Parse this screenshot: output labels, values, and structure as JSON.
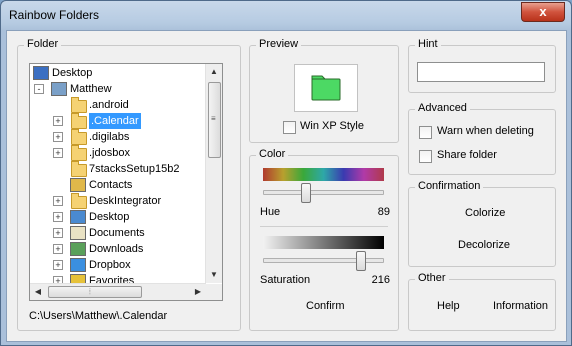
{
  "window": {
    "title": "Rainbow Folders",
    "close_glyph": "x"
  },
  "folder_panel": {
    "label": "Folder",
    "tree": [
      {
        "label": "Desktop",
        "icon": "desktop-icon",
        "expander": "",
        "selected": false
      },
      {
        "label": "Matthew",
        "icon": "user-folder-icon",
        "expander": "-",
        "selected": false
      },
      {
        "label": ".android",
        "icon": "folder-icon",
        "expander": "",
        "selected": false
      },
      {
        "label": ".Calendar",
        "icon": "folder-icon",
        "expander": "+",
        "selected": true
      },
      {
        "label": ".digilabs",
        "icon": "folder-icon",
        "expander": "+",
        "selected": false
      },
      {
        "label": ".jdosbox",
        "icon": "folder-icon",
        "expander": "+",
        "selected": false
      },
      {
        "label": "7stacksSetup15b2",
        "icon": "folder-icon",
        "expander": "",
        "selected": false
      },
      {
        "label": "Contacts",
        "icon": "contacts-icon",
        "expander": "",
        "selected": false
      },
      {
        "label": "DeskIntegrator",
        "icon": "folder-icon",
        "expander": "+",
        "selected": false
      },
      {
        "label": "Desktop",
        "icon": "desktop-folder-icon",
        "expander": "+",
        "selected": false
      },
      {
        "label": "Documents",
        "icon": "documents-icon",
        "expander": "+",
        "selected": false
      },
      {
        "label": "Downloads",
        "icon": "downloads-icon",
        "expander": "+",
        "selected": false
      },
      {
        "label": "Dropbox",
        "icon": "dropbox-icon",
        "expander": "+",
        "selected": false
      },
      {
        "label": "Favorites",
        "icon": "favorites-icon",
        "expander": "+",
        "selected": false
      }
    ],
    "selected_path": "C:\\Users\\Matthew\\.Calendar",
    "vertical_scroll_fraction": 0.0,
    "horizontal_scroll_fraction": 0.0
  },
  "preview_panel": {
    "label": "Preview",
    "folder_color": "#4cd964",
    "winxp_label": "Win XP Style",
    "winxp_checked": false
  },
  "color_panel": {
    "label": "Color",
    "hue_label": "Hue",
    "hue_value": "89",
    "hue_fraction": 0.35,
    "saturation_label": "Saturation",
    "saturation_value": "216",
    "saturation_fraction": 0.85,
    "confirm_label": "Confirm"
  },
  "hint_panel": {
    "label": "Hint",
    "value": ""
  },
  "advanced_panel": {
    "label": "Advanced",
    "warn_label": "Warn when deleting",
    "warn_checked": false,
    "share_label": "Share folder",
    "share_checked": false
  },
  "confirmation_panel": {
    "label": "Confirmation",
    "colorize_label": "Colorize",
    "decolorize_label": "Decolorize"
  },
  "other_panel": {
    "label": "Other",
    "help_label": "Help",
    "information_label": "Information"
  },
  "colors": {
    "selection": "#3399ff",
    "window_frame": "#b6cbe2",
    "close_button": "#d0533d"
  }
}
